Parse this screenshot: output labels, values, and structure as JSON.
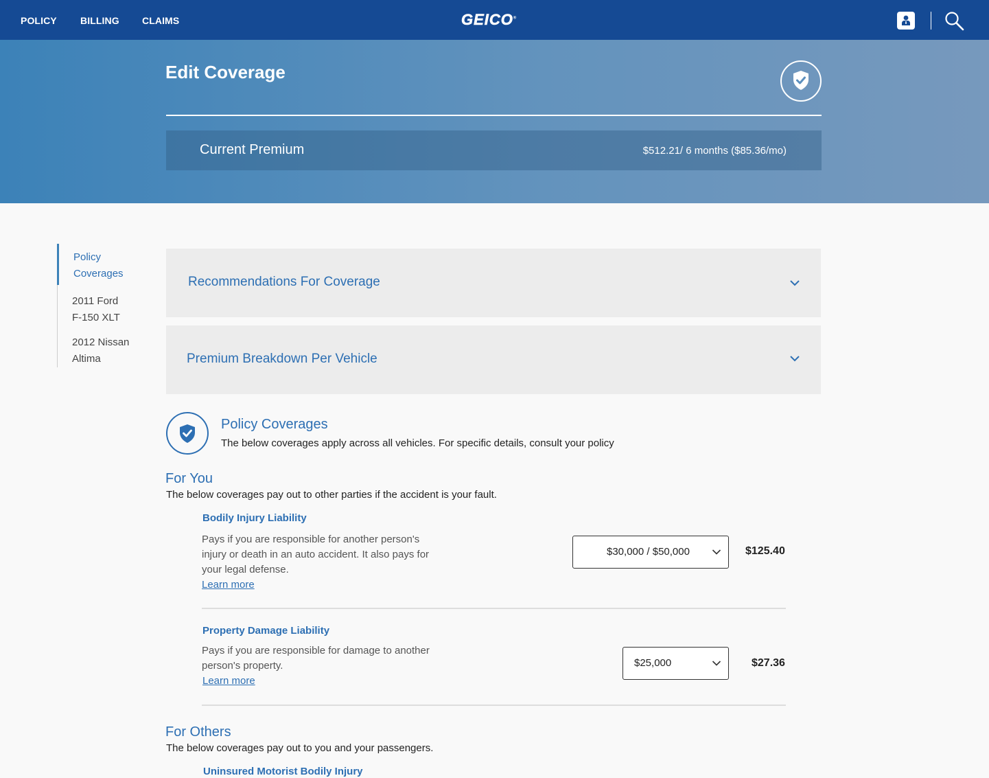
{
  "nav": {
    "links": [
      "POLICY",
      "BILLING",
      "CLAIMS"
    ],
    "logo": "GEICO",
    "logo_mark": "®",
    "user_icon": "user-icon",
    "search_icon": "search-icon"
  },
  "header": {
    "title": "Edit Coverage",
    "badge_icon": "shield-check-icon",
    "premium_label": "Current Premium",
    "premium_value": "$512.21/ 6 months ($85.36/mo)"
  },
  "sidenav": {
    "items": [
      {
        "label_line1": "Policy",
        "label_line2": "Coverages",
        "active": true
      },
      {
        "label_line1": "2011 Ford",
        "label_line2": "F-150 XLT",
        "active": false
      },
      {
        "label_line1": "2012 Nissan",
        "label_line2": "Altima",
        "active": false
      }
    ]
  },
  "accordions": [
    {
      "label": "Recommendations For Coverage",
      "icon": "chevron-down-icon"
    },
    {
      "label": "Premium Breakdown Per Vehicle",
      "icon": "chevron-down-icon"
    }
  ],
  "policy_coverages": {
    "title": "Policy Coverages",
    "description": "The below coverages apply across all vehicles. For specific details, consult your policy",
    "icon": "shield-check-icon"
  },
  "for_you": {
    "title": "For You",
    "description": "The below coverages pay out to other parties if the accident is your fault.",
    "coverages": [
      {
        "name": "Bodily Injury Liability",
        "description": "Pays if you are responsible for another person's injury or death in an auto accident. It also pays for your legal defense.",
        "learn_more": "Learn more",
        "selected": "$30,000 / $50,000",
        "price": "$125.40"
      },
      {
        "name": "Property Damage Liability",
        "description": "Pays if you are responsible for damage to another person's property.",
        "learn_more": "Learn more",
        "selected": "$25,000",
        "price": "$27.36"
      }
    ]
  },
  "for_others": {
    "title": "For Others",
    "description": "The below coverages pay out to you and your passengers.",
    "coverages": [
      {
        "name": "Uninsured Motorist Bodily Injury"
      }
    ]
  },
  "colors": {
    "nav_bg": "#154a94",
    "accent": "#2d6fb3"
  }
}
